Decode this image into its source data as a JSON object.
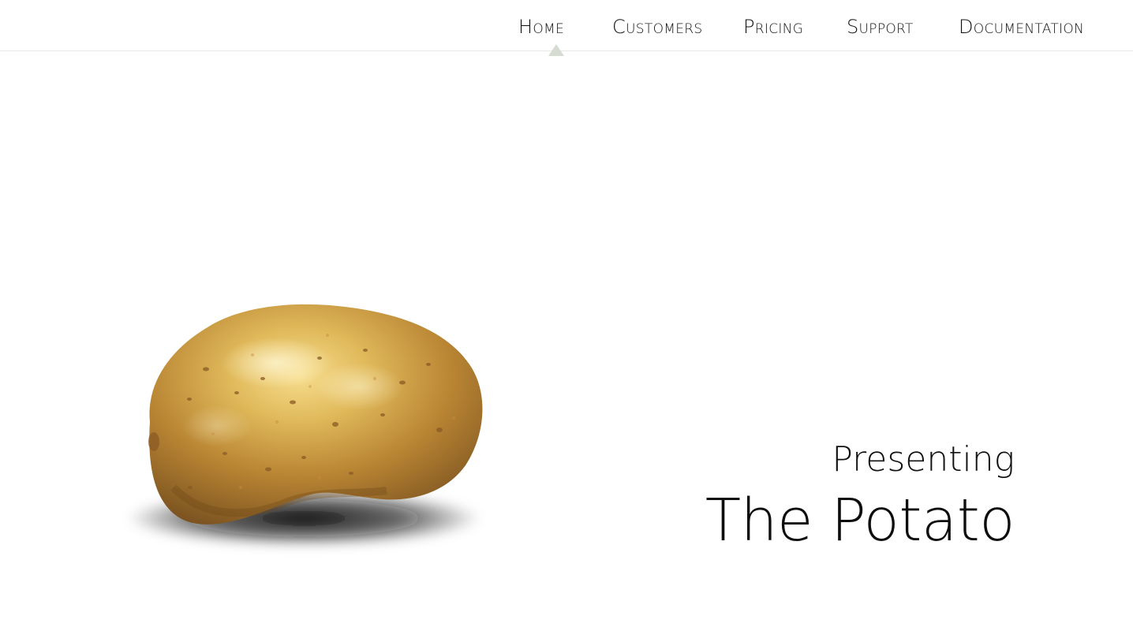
{
  "nav": {
    "items": [
      {
        "label": "Home",
        "active": true
      },
      {
        "label": "Customers",
        "active": false
      },
      {
        "label": "Pricing",
        "active": false
      },
      {
        "label": "Support",
        "active": false
      },
      {
        "label": "Documentation",
        "active": false
      }
    ]
  },
  "hero": {
    "eyebrow": "Presenting",
    "title": "The Potato",
    "image": "potato"
  },
  "colors": {
    "background": "#ffffff",
    "text": "#111111",
    "caret": "#d7dcd2",
    "border": "#e8e8e6"
  }
}
